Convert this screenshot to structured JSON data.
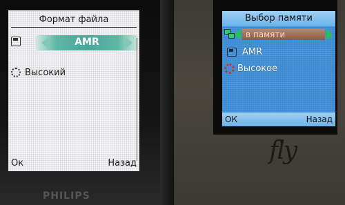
{
  "left_phone": {
    "title": "Формат файла",
    "format_value": "AMR",
    "quality_value": "Высокий",
    "softkey_left": "Ок",
    "softkey_right": "Назад",
    "brand": "PHILIPS",
    "colors": {
      "screen_bg": "#f3f3f6",
      "selector": "#4aa996"
    }
  },
  "right_phone": {
    "title": "Выбор памяти",
    "memory_value": "в памяти",
    "format_value": "AMR",
    "quality_value": "Высокое",
    "softkey_left": "ОК",
    "softkey_right": "Назад",
    "brand": "fly",
    "colors": {
      "screen_bg": "#3f8fd8",
      "header": "#9fd0f4",
      "selection": "#8a5c46",
      "arrows": "#26c24a"
    }
  },
  "icons": [
    "disk-icon",
    "gear-icon",
    "memory-icon",
    "arrow-left-icon",
    "arrow-right-icon"
  ]
}
